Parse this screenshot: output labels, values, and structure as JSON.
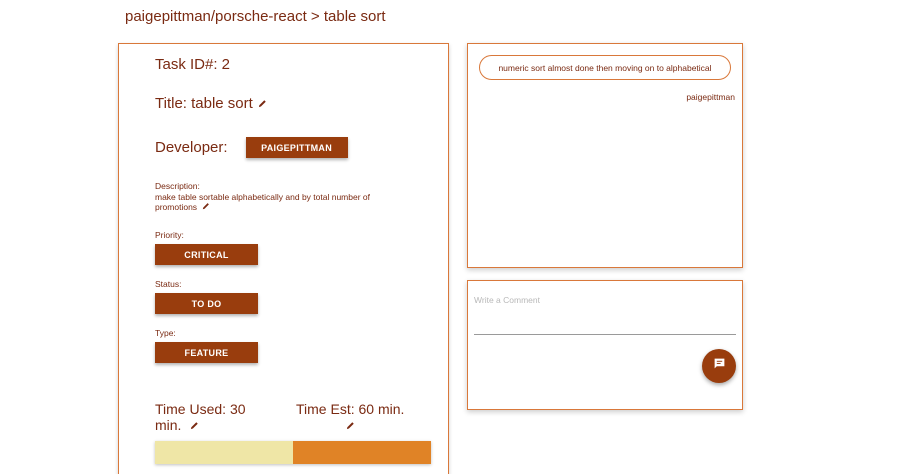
{
  "breadcrumb": "paigepittman/porsche-react > table sort",
  "task": {
    "id_label": "Task ID#: 2",
    "title_label": "Title: table sort",
    "developer_label": "Developer:",
    "developer_value": "PAIGEPITTMAN",
    "description_label": "Description:",
    "description_text": "make table sortable alphabetically and by total number of promotions",
    "priority_label": "Priority:",
    "priority_value": "CRITICAL",
    "status_label": "Status:",
    "status_value": "TO DO",
    "type_label": "Type:",
    "type_value": "FEATURE",
    "time_used_label": "Time Used: 30 min.",
    "time_est_label": "Time Est: 60 min.",
    "progress_fraction": 0.5
  },
  "comments": {
    "items": [
      {
        "text": "numeric sort almost done then moving on to alphabetical",
        "author": "paigepittman"
      }
    ],
    "input_placeholder": "Write a Comment"
  },
  "icons": {
    "edit": "pencil-icon",
    "send": "comment-icon"
  },
  "colors": {
    "accent_dark": "#993d0d",
    "accent_border": "#d9783a",
    "progress_used": "#efe6a6",
    "progress_remaining": "#e08326",
    "text": "#7a2a12"
  }
}
